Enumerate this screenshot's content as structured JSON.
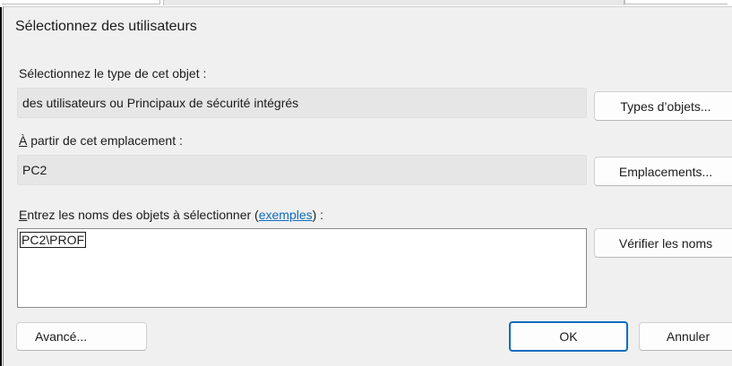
{
  "dialog": {
    "title": "Sélectionnez des utilisateurs",
    "object_type": {
      "label": "Sélectionnez le type de cet objet :",
      "value": "des utilisateurs ou Principaux de sécurité intégrés",
      "button": "Types d’objets..."
    },
    "location": {
      "label_rest": " partir de cet emplacement :",
      "label_accel": "À",
      "value": "PC2",
      "button": "Emplacements..."
    },
    "names": {
      "label_accel": "E",
      "label_part1": "ntrez les noms des objets à sélectionner (",
      "label_link": "exemples",
      "label_part2": ") :",
      "value": "PC2\\PROF",
      "check_button": "Vérifier les noms"
    },
    "buttons": {
      "advanced": "Avancé...",
      "ok": "OK",
      "cancel": "Annuler"
    }
  }
}
